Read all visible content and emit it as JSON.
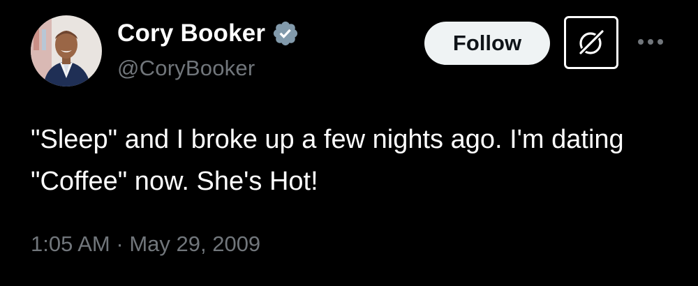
{
  "author": {
    "display_name": "Cory Booker",
    "handle": "@CoryBooker",
    "verified": true,
    "verified_color": "#829aab"
  },
  "actions": {
    "follow_label": "Follow",
    "grok_icon": "grok-icon",
    "more_icon": "more-icon"
  },
  "tweet": {
    "text": "\"Sleep\" and I broke up a few nights ago. I'm dating \"Coffee\" now. She's Hot!",
    "time": "1:05 AM",
    "separator": "·",
    "date": "May 29, 2009"
  },
  "colors": {
    "background": "#000000",
    "text": "#ffffff",
    "secondary": "#71767b",
    "follow_bg": "#eff3f4"
  }
}
